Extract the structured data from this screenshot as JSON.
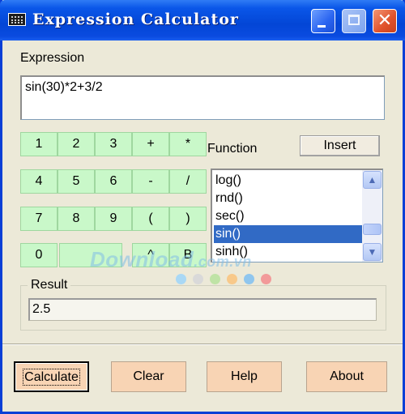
{
  "window": {
    "title": "Expression Calculator"
  },
  "expression": {
    "label": "Expression",
    "value": "sin(30)*2+3/2"
  },
  "keypad": {
    "rows": [
      [
        "1",
        "2",
        "3",
        "+",
        "*"
      ],
      [
        "4",
        "5",
        "6",
        "-",
        "/"
      ],
      [
        "7",
        "8",
        "9",
        "(",
        ")"
      ],
      [
        "0",
        "",
        "^",
        "B"
      ]
    ]
  },
  "function": {
    "label": "Function",
    "insert_label": "Insert",
    "items": [
      "log()",
      "rnd()",
      "sec()",
      "sin()",
      "sinh()"
    ],
    "selected": "sin()"
  },
  "result": {
    "label": "Result",
    "value": "2.5"
  },
  "actions": {
    "calculate": "Calculate",
    "clear": "Clear",
    "help": "Help",
    "about": "About"
  },
  "watermark": {
    "text": "Download",
    "suffix": ".com.vn"
  },
  "colors": {
    "titlebar": "#0a56e8",
    "keypad_bg": "#c9f8c9",
    "action_bg": "#f8d4b4",
    "selection": "#316ac5",
    "dots": [
      "#a9d8f5",
      "#d9d9d9",
      "#bfe3a6",
      "#f8c98a",
      "#8fc6ee",
      "#f29a9a"
    ]
  }
}
